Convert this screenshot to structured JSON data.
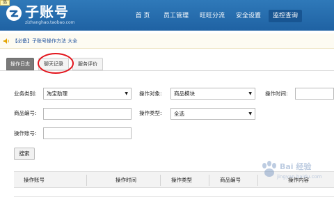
{
  "header": {
    "corner_tag": "品",
    "logo_title": "子账号",
    "logo_subtitle": "zizhanghao.taobao.com",
    "nav": [
      {
        "label": "首 页"
      },
      {
        "label": "员工管理"
      },
      {
        "label": "旺旺分流"
      },
      {
        "label": "安全设置"
      },
      {
        "label": "监控查询"
      }
    ],
    "active_nav": "监控查询"
  },
  "notice": {
    "text": "【必备】子账号操作方法 大全"
  },
  "tabs": [
    {
      "label": "操作日志"
    },
    {
      "label": "聊天记录"
    },
    {
      "label": "服务评价"
    }
  ],
  "form": {
    "business_type_label": "业务类别:",
    "business_type_value": "淘宝助理",
    "operation_object_label": "操作对象:",
    "operation_object_value": "商品模块",
    "operation_time_label": "操作时间:",
    "product_id_label": "商品编号:",
    "operation_type_label": "操作类型:",
    "operation_type_value": "全选",
    "operator_account_label": "操作账号:",
    "search_button": "搜索"
  },
  "table": {
    "columns": [
      "操作账号",
      "操作时间",
      "操作类型",
      "商品编号",
      "操作内容"
    ]
  },
  "watermark": {
    "text": "Bai 经验",
    "url": "jingyan.baidu.com"
  }
}
